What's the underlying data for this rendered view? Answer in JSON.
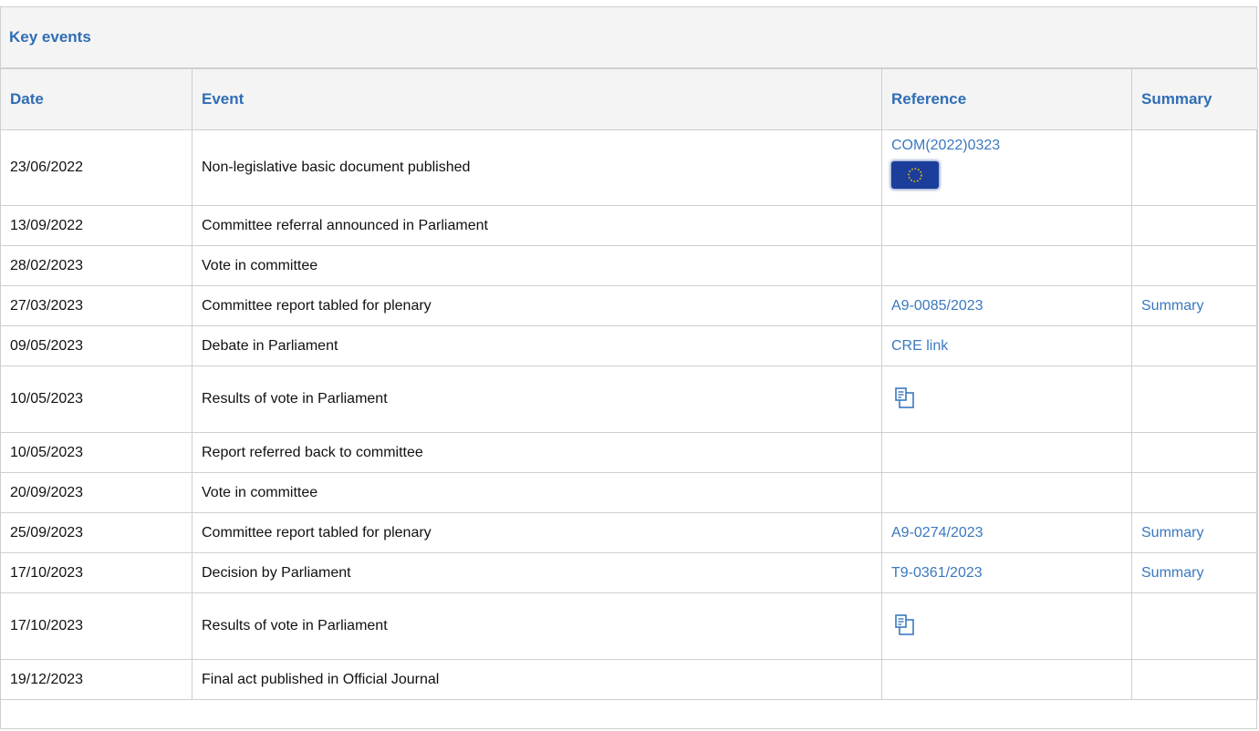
{
  "panel": {
    "title": "Key events"
  },
  "table": {
    "headers": {
      "date": "Date",
      "event": "Event",
      "reference": "Reference",
      "summary": "Summary"
    },
    "rows": [
      {
        "date": "23/06/2022",
        "event": "Non-legislative basic document published",
        "reference": "COM(2022)0323",
        "reference_icon": "eu-flag-icon",
        "summary": ""
      },
      {
        "date": "13/09/2022",
        "event": "Committee referral announced in Parliament",
        "reference": "",
        "summary": ""
      },
      {
        "date": "28/02/2023",
        "event": "Vote in committee",
        "reference": "",
        "summary": ""
      },
      {
        "date": "27/03/2023",
        "event": "Committee report tabled for plenary",
        "reference": "A9-0085/2023",
        "summary": "Summary"
      },
      {
        "date": "09/05/2023",
        "event": "Debate in Parliament",
        "reference": "CRE link",
        "summary": ""
      },
      {
        "date": "10/05/2023",
        "event": "Results of vote in Parliament",
        "reference": "",
        "reference_icon": "vote-results-icon",
        "summary": ""
      },
      {
        "date": "10/05/2023",
        "event": "Report referred back to committee",
        "reference": "",
        "summary": ""
      },
      {
        "date": "20/09/2023",
        "event": "Vote in committee",
        "reference": "",
        "summary": ""
      },
      {
        "date": "25/09/2023",
        "event": "Committee report tabled for plenary",
        "reference": "A9-0274/2023",
        "summary": "Summary"
      },
      {
        "date": "17/10/2023",
        "event": "Decision by Parliament",
        "reference": "T9-0361/2023",
        "summary": "Summary"
      },
      {
        "date": "17/10/2023",
        "event": "Results of vote in Parliament",
        "reference": "",
        "reference_icon": "vote-results-icon",
        "summary": ""
      },
      {
        "date": "19/12/2023",
        "event": "Final act published in Official Journal",
        "reference": "",
        "summary": ""
      }
    ]
  },
  "colors": {
    "accent": "#2f6db5",
    "link": "#3a78c0",
    "border": "#cfcfcf",
    "header_bg": "#f4f4f4",
    "flag": "#1a3e9a"
  }
}
